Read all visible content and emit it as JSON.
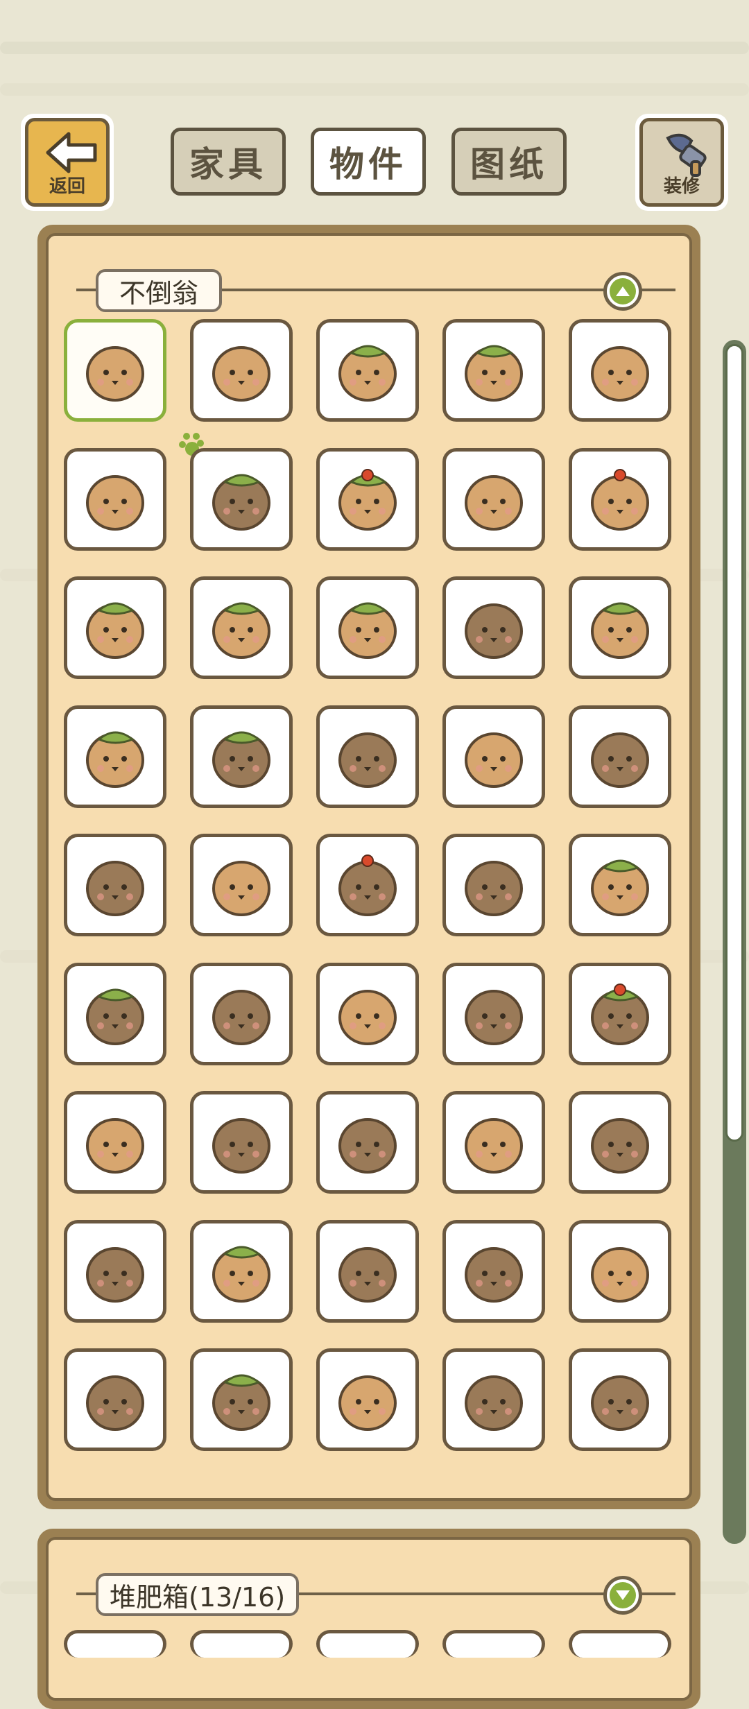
{
  "header": {
    "back_label": "返回",
    "decorate_label": "装修",
    "tabs": [
      {
        "label": "家具",
        "active": false
      },
      {
        "label": "物件",
        "active": true
      },
      {
        "label": "图纸",
        "active": false
      }
    ]
  },
  "sections": [
    {
      "title": "不倒翁",
      "expanded": true,
      "item_count_visible": 45,
      "selected_index": 0
    },
    {
      "title": "堆肥箱(13/16)",
      "expanded": false
    }
  ],
  "colors": {
    "accent_green": "#8ab03c",
    "panel_bg": "#f7ddb0",
    "panel_border": "#9b8052",
    "cell_border": "#6a5840",
    "light_doll": "#d7a66f",
    "dark_doll": "#9a7a58",
    "leaf": "#8bb04a",
    "berry": "#d94a2c"
  },
  "icons": {
    "back": "arrow-left-icon",
    "decorate": "brush-icon",
    "collapse": "chevron-up-icon",
    "expand": "chevron-down-icon",
    "selected_marker": "paw-icon"
  }
}
